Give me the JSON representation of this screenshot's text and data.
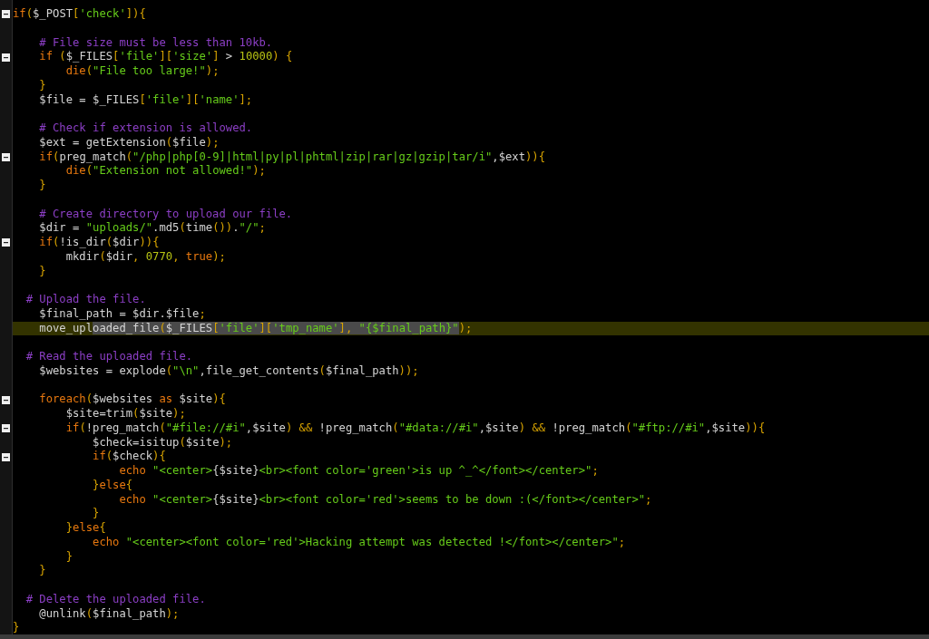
{
  "lines": [
    {
      "fold": true,
      "current": false,
      "tokens": [
        {
          "kind": "keyword",
          "text": "if"
        },
        {
          "kind": "punct",
          "text": "("
        },
        {
          "kind": "plain",
          "text": "$_POST"
        },
        {
          "kind": "punct",
          "text": "["
        },
        {
          "kind": "string",
          "text": "'check'"
        },
        {
          "kind": "punct",
          "text": "]){"
        }
      ]
    },
    {
      "fold": false,
      "current": false
    },
    {
      "fold": false,
      "current": false,
      "tokens": [
        {
          "kind": "comment",
          "text": "    # File size must be less than 10kb."
        }
      ]
    },
    {
      "fold": true,
      "current": false,
      "tokens": [
        {
          "kind": "keyword",
          "text": "    if"
        },
        {
          "kind": "punct",
          "text": " ("
        },
        {
          "kind": "plain",
          "text": "$_FILES"
        },
        {
          "kind": "punct",
          "text": "["
        },
        {
          "kind": "string",
          "text": "'file'"
        },
        {
          "kind": "punct",
          "text": "]["
        },
        {
          "kind": "string",
          "text": "'size'"
        },
        {
          "kind": "punct",
          "text": "]"
        },
        {
          "kind": "plain",
          "text": " > "
        },
        {
          "kind": "number",
          "text": "10000"
        },
        {
          "kind": "punct",
          "text": ") {"
        }
      ]
    },
    {
      "fold": false,
      "current": false,
      "tokens": [
        {
          "kind": "keyword",
          "text": "        die"
        },
        {
          "kind": "punct",
          "text": "("
        },
        {
          "kind": "string",
          "text": "\"File too large!\""
        },
        {
          "kind": "punct",
          "text": ");"
        }
      ]
    },
    {
      "fold": false,
      "current": false,
      "tokens": [
        {
          "kind": "punct",
          "text": "    }"
        }
      ]
    },
    {
      "fold": false,
      "current": false,
      "tokens": [
        {
          "kind": "plain",
          "text": "    $file = $_FILES"
        },
        {
          "kind": "punct",
          "text": "["
        },
        {
          "kind": "string",
          "text": "'file'"
        },
        {
          "kind": "punct",
          "text": "]["
        },
        {
          "kind": "string",
          "text": "'name'"
        },
        {
          "kind": "punct",
          "text": "];"
        }
      ]
    },
    {
      "fold": false,
      "current": false
    },
    {
      "fold": false,
      "current": false,
      "tokens": [
        {
          "kind": "comment",
          "text": "    # Check if extension is allowed."
        }
      ]
    },
    {
      "fold": false,
      "current": false,
      "tokens": [
        {
          "kind": "plain",
          "text": "    $ext = getExtension"
        },
        {
          "kind": "punct",
          "text": "("
        },
        {
          "kind": "plain",
          "text": "$file"
        },
        {
          "kind": "punct",
          "text": ");"
        }
      ]
    },
    {
      "fold": true,
      "current": false,
      "tokens": [
        {
          "kind": "keyword",
          "text": "    if"
        },
        {
          "kind": "punct",
          "text": "("
        },
        {
          "kind": "plain",
          "text": "preg_match"
        },
        {
          "kind": "punct",
          "text": "("
        },
        {
          "kind": "string",
          "text": "\"/php|php[0-9]|html|py|pl|phtml|zip|rar|gz|gzip|tar/i\""
        },
        {
          "kind": "plain",
          "text": ",$ext"
        },
        {
          "kind": "punct",
          "text": ")){"
        }
      ]
    },
    {
      "fold": false,
      "current": false,
      "tokens": [
        {
          "kind": "keyword",
          "text": "        die"
        },
        {
          "kind": "punct",
          "text": "("
        },
        {
          "kind": "string",
          "text": "\"Extension not allowed!\""
        },
        {
          "kind": "punct",
          "text": ");"
        }
      ]
    },
    {
      "fold": false,
      "current": false,
      "tokens": [
        {
          "kind": "punct",
          "text": "    }"
        }
      ]
    },
    {
      "fold": false,
      "current": false
    },
    {
      "fold": false,
      "current": false,
      "tokens": [
        {
          "kind": "comment",
          "text": "    # Create directory to upload our file."
        }
      ]
    },
    {
      "fold": false,
      "current": false,
      "tokens": [
        {
          "kind": "plain",
          "text": "    $dir = "
        },
        {
          "kind": "string",
          "text": "\"uploads/\""
        },
        {
          "kind": "plain",
          "text": ".md5"
        },
        {
          "kind": "punct",
          "text": "("
        },
        {
          "kind": "plain",
          "text": "time"
        },
        {
          "kind": "punct",
          "text": "())"
        },
        {
          "kind": "plain",
          "text": "."
        },
        {
          "kind": "string",
          "text": "\"/\""
        },
        {
          "kind": "punct",
          "text": ";"
        }
      ]
    },
    {
      "fold": true,
      "current": false,
      "tokens": [
        {
          "kind": "keyword",
          "text": "    if"
        },
        {
          "kind": "punct",
          "text": "("
        },
        {
          "kind": "plain",
          "text": "!is_dir"
        },
        {
          "kind": "punct",
          "text": "("
        },
        {
          "kind": "plain",
          "text": "$dir"
        },
        {
          "kind": "punct",
          "text": ")){"
        }
      ]
    },
    {
      "fold": false,
      "current": false,
      "tokens": [
        {
          "kind": "plain",
          "text": "        mkdir"
        },
        {
          "kind": "punct",
          "text": "("
        },
        {
          "kind": "plain",
          "text": "$dir"
        },
        {
          "kind": "punct",
          "text": ", "
        },
        {
          "kind": "number",
          "text": "0770"
        },
        {
          "kind": "punct",
          "text": ", "
        },
        {
          "kind": "keyword",
          "text": "true"
        },
        {
          "kind": "punct",
          "text": ");"
        }
      ]
    },
    {
      "fold": false,
      "current": false,
      "tokens": [
        {
          "kind": "punct",
          "text": "    }"
        }
      ]
    },
    {
      "fold": false,
      "current": false
    },
    {
      "fold": false,
      "current": false,
      "tokens": [
        {
          "kind": "comment",
          "text": "  # Upload the file."
        }
      ]
    },
    {
      "fold": false,
      "current": false,
      "tokens": [
        {
          "kind": "plain",
          "text": "    $final_path = $dir.$file"
        },
        {
          "kind": "punct",
          "text": ";"
        }
      ]
    },
    {
      "fold": false,
      "current": true,
      "tokens": [
        {
          "kind": "plain",
          "text": "    move_upl",
          "selected": false
        },
        {
          "kind": "plain",
          "text": "oaded_file",
          "selected": true
        },
        {
          "kind": "punct",
          "text": "(",
          "selected": true
        },
        {
          "kind": "plain",
          "text": "$_FILES",
          "selected": true
        },
        {
          "kind": "punct",
          "text": "[",
          "selected": true
        },
        {
          "kind": "string",
          "text": "'file'",
          "selected": true
        },
        {
          "kind": "punct",
          "text": "][",
          "selected": true
        },
        {
          "kind": "string",
          "text": "'tmp_name'",
          "selected": true
        },
        {
          "kind": "punct",
          "text": "], ",
          "selected": true
        },
        {
          "kind": "string",
          "text": "\"{$final_path}\"",
          "selected": true
        },
        {
          "kind": "punct",
          "text": ");",
          "selected": false
        }
      ]
    },
    {
      "fold": false,
      "current": false
    },
    {
      "fold": false,
      "current": false,
      "tokens": [
        {
          "kind": "comment",
          "text": "  # Read the uploaded file."
        }
      ]
    },
    {
      "fold": false,
      "current": false,
      "tokens": [
        {
          "kind": "plain",
          "text": "    $websites = explode"
        },
        {
          "kind": "punct",
          "text": "("
        },
        {
          "kind": "string",
          "text": "\"\\n\""
        },
        {
          "kind": "plain",
          "text": ",file_get_contents"
        },
        {
          "kind": "punct",
          "text": "("
        },
        {
          "kind": "plain",
          "text": "$final_path"
        },
        {
          "kind": "punct",
          "text": "));"
        }
      ]
    },
    {
      "fold": false,
      "current": false
    },
    {
      "fold": true,
      "current": false,
      "tokens": [
        {
          "kind": "keyword",
          "text": "    foreach"
        },
        {
          "kind": "punct",
          "text": "("
        },
        {
          "kind": "plain",
          "text": "$websites "
        },
        {
          "kind": "keyword",
          "text": "as"
        },
        {
          "kind": "plain",
          "text": " $site"
        },
        {
          "kind": "punct",
          "text": "){"
        }
      ]
    },
    {
      "fold": false,
      "current": false,
      "tokens": [
        {
          "kind": "plain",
          "text": "        $site=trim"
        },
        {
          "kind": "punct",
          "text": "("
        },
        {
          "kind": "plain",
          "text": "$site"
        },
        {
          "kind": "punct",
          "text": ");"
        }
      ]
    },
    {
      "fold": true,
      "current": false,
      "tokens": [
        {
          "kind": "keyword",
          "text": "        if"
        },
        {
          "kind": "punct",
          "text": "("
        },
        {
          "kind": "plain",
          "text": "!preg_match"
        },
        {
          "kind": "punct",
          "text": "("
        },
        {
          "kind": "string",
          "text": "\"#file://#i\""
        },
        {
          "kind": "plain",
          "text": ",$site"
        },
        {
          "kind": "punct",
          "text": ") && "
        },
        {
          "kind": "plain",
          "text": "!preg_match"
        },
        {
          "kind": "punct",
          "text": "("
        },
        {
          "kind": "string",
          "text": "\"#data://#i\""
        },
        {
          "kind": "plain",
          "text": ",$site"
        },
        {
          "kind": "punct",
          "text": ") && "
        },
        {
          "kind": "plain",
          "text": "!preg_match"
        },
        {
          "kind": "punct",
          "text": "("
        },
        {
          "kind": "string",
          "text": "\"#ftp://#i\""
        },
        {
          "kind": "plain",
          "text": ",$site"
        },
        {
          "kind": "punct",
          "text": ")){"
        }
      ]
    },
    {
      "fold": false,
      "current": false,
      "tokens": [
        {
          "kind": "plain",
          "text": "            $check=isitup"
        },
        {
          "kind": "punct",
          "text": "("
        },
        {
          "kind": "plain",
          "text": "$site"
        },
        {
          "kind": "punct",
          "text": ");"
        }
      ]
    },
    {
      "fold": true,
      "current": false,
      "tokens": [
        {
          "kind": "keyword",
          "text": "            if"
        },
        {
          "kind": "punct",
          "text": "("
        },
        {
          "kind": "plain",
          "text": "$check"
        },
        {
          "kind": "punct",
          "text": "){"
        }
      ]
    },
    {
      "fold": false,
      "current": false,
      "tokens": [
        {
          "kind": "keyword",
          "text": "                echo"
        },
        {
          "kind": "string",
          "text": " \"<center>"
        },
        {
          "kind": "plain",
          "text": "{$site}"
        },
        {
          "kind": "string",
          "text": "<br><font color='green'>is up ^_^</font></center>\""
        },
        {
          "kind": "punct",
          "text": ";"
        }
      ]
    },
    {
      "fold": false,
      "current": false,
      "tokens": [
        {
          "kind": "punct",
          "text": "            }"
        },
        {
          "kind": "keyword",
          "text": "else"
        },
        {
          "kind": "punct",
          "text": "{"
        }
      ]
    },
    {
      "fold": false,
      "current": false,
      "tokens": [
        {
          "kind": "keyword",
          "text": "                echo"
        },
        {
          "kind": "string",
          "text": " \"<center>"
        },
        {
          "kind": "plain",
          "text": "{$site}"
        },
        {
          "kind": "string",
          "text": "<br><font color='red'>seems to be down :(</font></center>\""
        },
        {
          "kind": "punct",
          "text": ";"
        }
      ]
    },
    {
      "fold": false,
      "current": false,
      "tokens": [
        {
          "kind": "punct",
          "text": "            }"
        }
      ]
    },
    {
      "fold": false,
      "current": false,
      "tokens": [
        {
          "kind": "punct",
          "text": "        }"
        },
        {
          "kind": "keyword",
          "text": "else"
        },
        {
          "kind": "punct",
          "text": "{"
        }
      ]
    },
    {
      "fold": false,
      "current": false,
      "tokens": [
        {
          "kind": "keyword",
          "text": "            echo"
        },
        {
          "kind": "string",
          "text": " \"<center><font color='red'>Hacking attempt was detected !</font></center>\""
        },
        {
          "kind": "punct",
          "text": ";"
        }
      ]
    },
    {
      "fold": false,
      "current": false,
      "tokens": [
        {
          "kind": "punct",
          "text": "        }"
        }
      ]
    },
    {
      "fold": false,
      "current": false,
      "tokens": [
        {
          "kind": "punct",
          "text": "    }"
        }
      ]
    },
    {
      "fold": false,
      "current": false
    },
    {
      "fold": false,
      "current": false,
      "tokens": [
        {
          "kind": "comment",
          "text": "  # Delete the uploaded file."
        }
      ]
    },
    {
      "fold": false,
      "current": false,
      "tokens": [
        {
          "kind": "plain",
          "text": "    @unlink"
        },
        {
          "kind": "punct",
          "text": "("
        },
        {
          "kind": "plain",
          "text": "$final_path"
        },
        {
          "kind": "punct",
          "text": ");"
        }
      ]
    },
    {
      "fold": false,
      "current": false,
      "tokens": [
        {
          "kind": "punct",
          "text": "}"
        }
      ]
    }
  ]
}
